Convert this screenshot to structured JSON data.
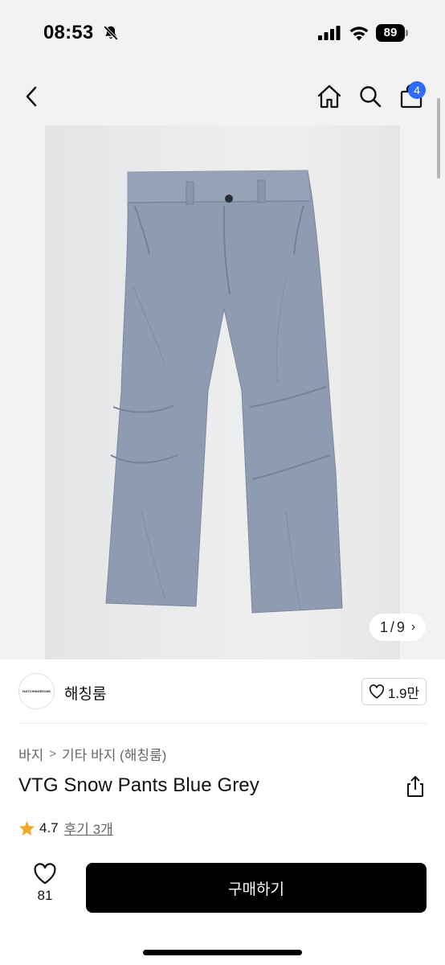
{
  "status_bar": {
    "time": "08:53",
    "battery": "89",
    "icons": [
      "bell-slash-icon",
      "signal-icon",
      "wifi-icon",
      "battery-icon"
    ]
  },
  "nav": {
    "icons": [
      "chevron-left-icon",
      "home-icon",
      "search-icon",
      "shopping-bag-icon"
    ],
    "cart_count": "4"
  },
  "gallery": {
    "counter_current": "1",
    "counter_sep": "/",
    "counter_total": "9",
    "counter_arrow": "›"
  },
  "shop": {
    "logo_text": "HATCHINGROOM",
    "name": "해칭룸",
    "follow_count": "1.9만"
  },
  "product": {
    "category": [
      "바지",
      "기타 바지 (해칭룸)"
    ],
    "title": "VTG Snow Pants Blue Grey",
    "rating": "4.7",
    "reviews": "후기 3개"
  },
  "bottom_bar": {
    "like_count": "81",
    "buy_label": "구매하기"
  },
  "colors": {
    "accent_badge": "#2d6bff",
    "star": "#f4a92a",
    "pants": "#8f9bb0",
    "buy_button": "#000000"
  }
}
